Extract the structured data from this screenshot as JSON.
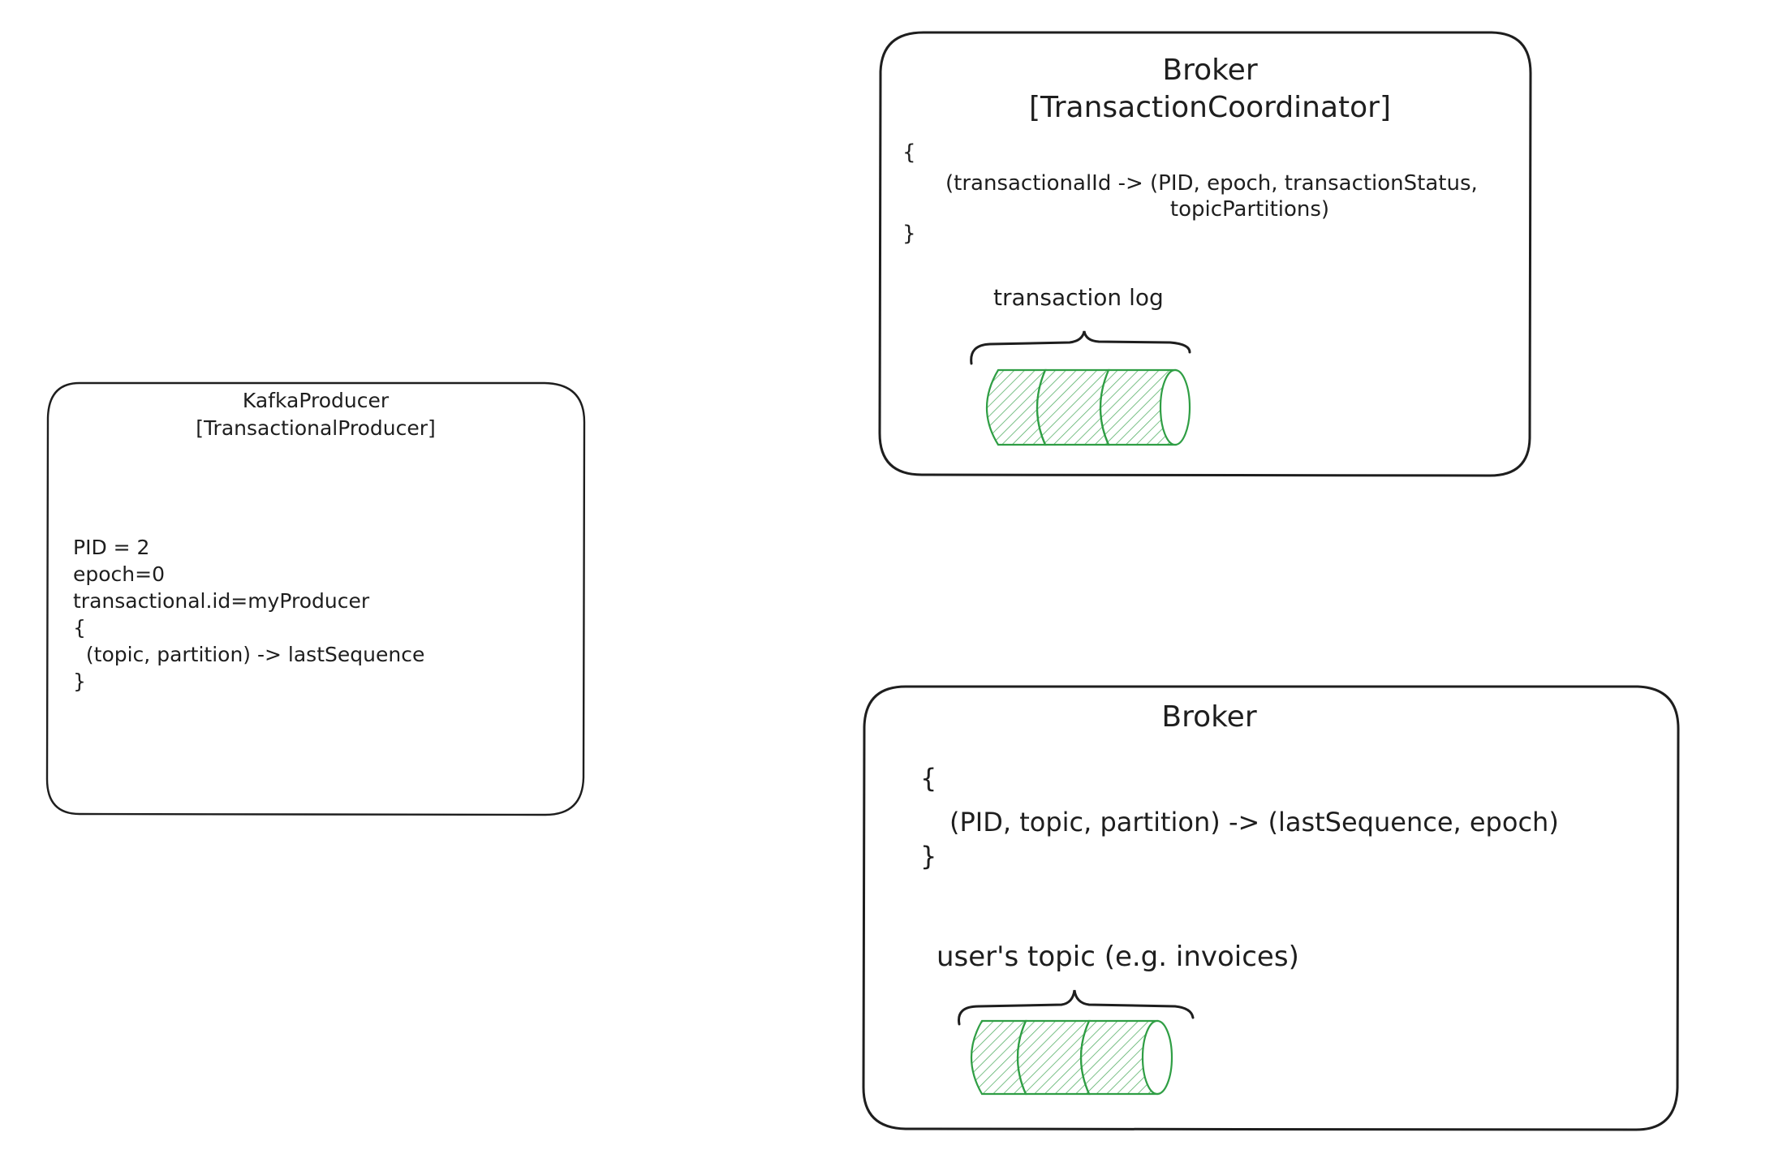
{
  "producer": {
    "title_line1": "KafkaProducer",
    "title_line2": "[TransactionalProducer]",
    "state_lines": [
      "PID = 2",
      "epoch=0",
      "transactional.id=myProducer",
      "{",
      "  (topic, partition) -> lastSequence",
      "}"
    ]
  },
  "coordinator_broker": {
    "title_line1": "Broker",
    "title_line2": "[TransactionCoordinator]",
    "state_lines": [
      "{",
      "(transactionalId -> (PID, epoch, transactionStatus,",
      "topicPartitions)",
      "}"
    ],
    "log_label": "transaction log"
  },
  "data_broker": {
    "title_line1": "Broker",
    "state_lines": [
      "{",
      "(PID, topic, partition) -> (lastSequence, epoch)",
      "}"
    ],
    "log_label": "user's topic (e.g. invoices)"
  },
  "colors": {
    "stroke": "#1e1e1e",
    "log_stroke": "#2f9e44",
    "log_fill": "#b2f2bb"
  }
}
